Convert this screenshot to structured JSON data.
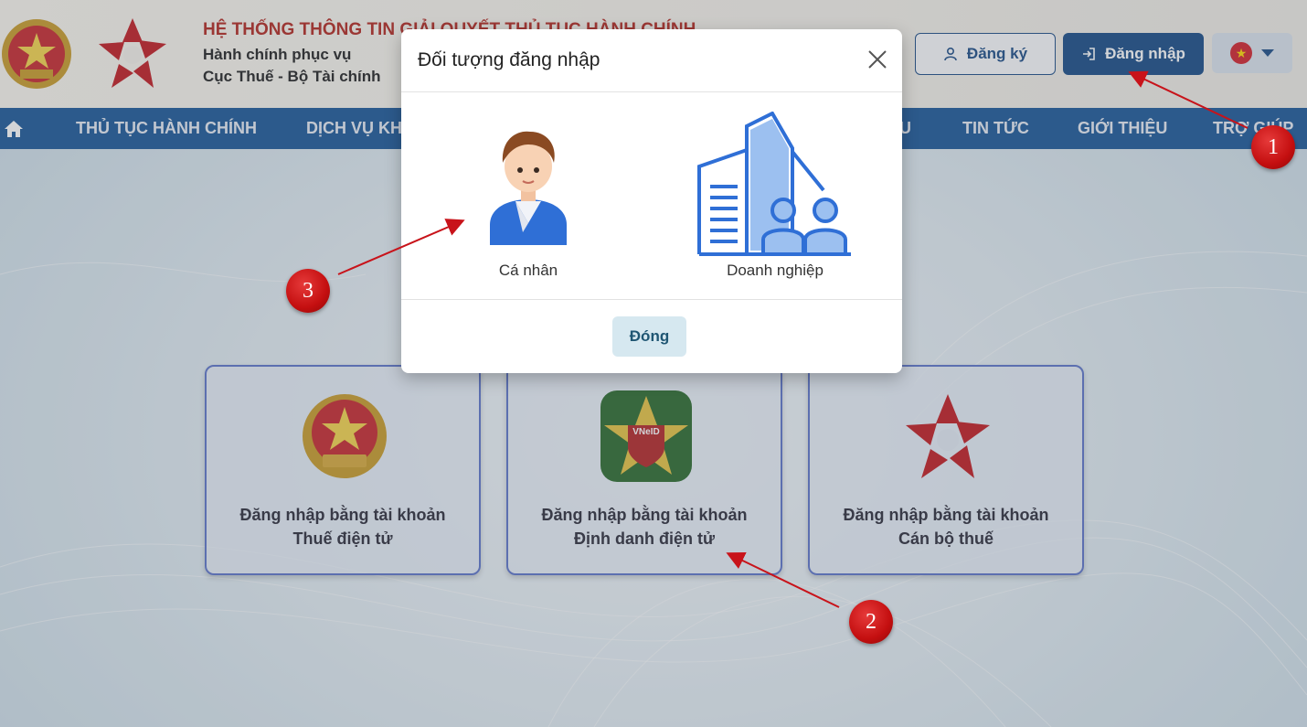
{
  "header": {
    "title_main": "HỆ THỐNG THÔNG TIN GIẢI QUYẾT THỦ TỤC HÀNH CHÍNH",
    "subtitle_line1": "Hành chính phục vụ",
    "subtitle_line2": "Cục Thuế - Bộ Tài chính",
    "register_label": "Đăng ký",
    "login_label": "Đăng nhập",
    "language_flag": "vietnam-flag-icon"
  },
  "nav": {
    "items": [
      {
        "label": "THỦ TỤC HÀNH CHÍNH"
      },
      {
        "label": "DỊCH VỤ KH"
      },
      {
        "label": "U"
      },
      {
        "label": "TIN TỨC"
      },
      {
        "label": "GIỚI THIỆU"
      },
      {
        "label": "TRỢ GIÚP"
      }
    ]
  },
  "cards": [
    {
      "line1": "Đăng nhập bằng tài khoản",
      "line2": "Thuế điện tử",
      "icon": "national-emblem-icon"
    },
    {
      "line1": "Đăng nhập bằng tài khoản",
      "line2": "Định danh điện tử",
      "icon": "vneid-icon"
    },
    {
      "line1": "Đăng nhập bằng tài khoản",
      "line2": "Cán bộ thuế",
      "icon": "red-star-hands-icon"
    }
  ],
  "modal": {
    "title": "Đối tượng đăng nhập",
    "options": [
      {
        "label": "Cá nhân",
        "icon": "person-icon"
      },
      {
        "label": "Doanh nghiệp",
        "icon": "building-icon"
      }
    ],
    "close_label": "Đóng"
  },
  "annotations": [
    {
      "number": "1"
    },
    {
      "number": "2"
    },
    {
      "number": "3"
    }
  ],
  "colors": {
    "nav_bg": "#1a5797",
    "title_red": "#b3261e",
    "login_bg": "#174a86",
    "card_border": "#5c74c9",
    "annotation_red": "#c40f10"
  }
}
